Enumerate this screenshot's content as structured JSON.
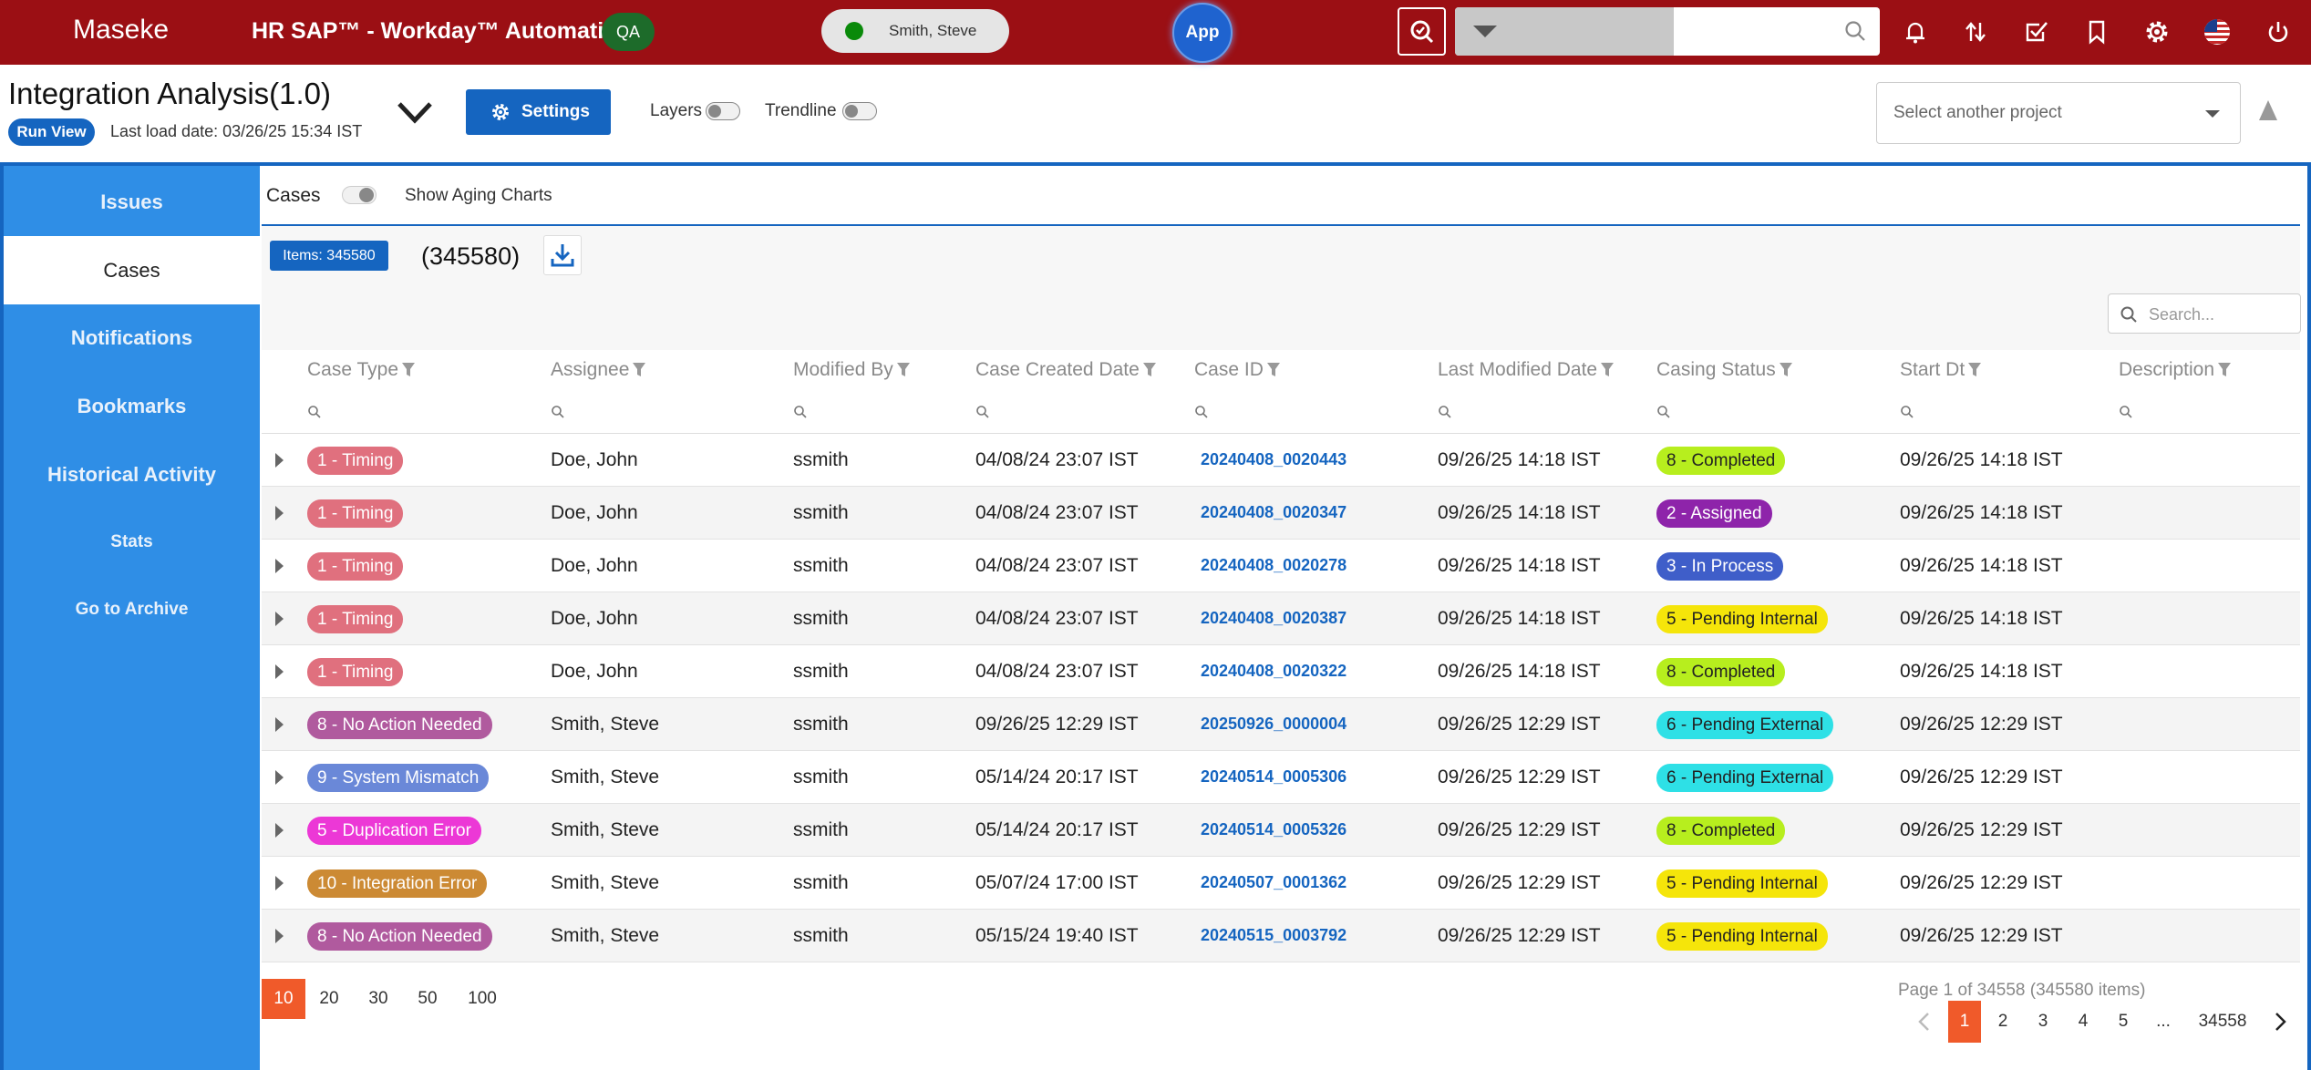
{
  "topbar": {
    "brand": "Maseke",
    "app_title": "HR SAP™ - Workday™ Automation",
    "env_badge": "QA",
    "user_name": "Smith, Steve",
    "app_button": "App",
    "search_placeholder": "",
    "icons": [
      "search-check-icon",
      "magnifier-icon",
      "bell-icon",
      "sort-arrows-icon",
      "checkbox-icon",
      "bookmark-icon",
      "gear-icon",
      "us-flag-icon",
      "power-icon"
    ]
  },
  "header": {
    "title": "Integration Analysis(1.0)",
    "run_view": "Run View",
    "last_load": "Last load date: 03/26/25 15:34 IST",
    "settings": "Settings",
    "layers": "Layers",
    "trendline": "Trendline",
    "project_placeholder": "Select another project"
  },
  "sidebar": {
    "items": [
      {
        "label": "Issues",
        "active": false
      },
      {
        "label": "Cases",
        "active": true
      },
      {
        "label": "Notifications",
        "active": false
      },
      {
        "label": "Bookmarks",
        "active": false
      },
      {
        "label": "Historical Activity",
        "active": false
      },
      {
        "label": "Stats",
        "active": false
      },
      {
        "label": "Go to Archive",
        "active": false
      }
    ]
  },
  "cases": {
    "section_label": "Cases",
    "aging_toggle": "Show Aging Charts",
    "items_badge": "Items: 345580",
    "count": "(345580)",
    "search_placeholder": "Search..."
  },
  "table": {
    "columns": [
      "Case Type",
      "Assignee",
      "Modified By",
      "Case Created Date",
      "Case ID",
      "Last Modified Date",
      "Casing Status",
      "Start Dt",
      "Description"
    ],
    "rows": [
      {
        "type": "1 - Timing",
        "type_color": "#e0707e",
        "assignee": "Doe, John",
        "modified_by": "ssmith",
        "created": "04/08/24 23:07 IST",
        "case_id": "20240408_0020443",
        "last_modified": "09/26/25 14:18 IST",
        "status": "8 - Completed",
        "status_bg": "#b7ee1e",
        "status_fg": "#222",
        "start": "09/26/25 14:18 IST",
        "description": ""
      },
      {
        "type": "1 - Timing",
        "type_color": "#e0707e",
        "assignee": "Doe, John",
        "modified_by": "ssmith",
        "created": "04/08/24 23:07 IST",
        "case_id": "20240408_0020347",
        "last_modified": "09/26/25 14:18 IST",
        "status": "2 - Assigned",
        "status_bg": "#8e24aa",
        "status_fg": "#fff",
        "start": "09/26/25 14:18 IST",
        "description": ""
      },
      {
        "type": "1 - Timing",
        "type_color": "#e0707e",
        "assignee": "Doe, John",
        "modified_by": "ssmith",
        "created": "04/08/24 23:07 IST",
        "case_id": "20240408_0020278",
        "last_modified": "09/26/25 14:18 IST",
        "status": "3 - In Process",
        "status_bg": "#3f5ec9",
        "status_fg": "#fff",
        "start": "09/26/25 14:18 IST",
        "description": ""
      },
      {
        "type": "1 - Timing",
        "type_color": "#e0707e",
        "assignee": "Doe, John",
        "modified_by": "ssmith",
        "created": "04/08/24 23:07 IST",
        "case_id": "20240408_0020387",
        "last_modified": "09/26/25 14:18 IST",
        "status": "5 - Pending Internal",
        "status_bg": "#f5e50a",
        "status_fg": "#222",
        "start": "09/26/25 14:18 IST",
        "description": ""
      },
      {
        "type": "1 - Timing",
        "type_color": "#e0707e",
        "assignee": "Doe, John",
        "modified_by": "ssmith",
        "created": "04/08/24 23:07 IST",
        "case_id": "20240408_0020322",
        "last_modified": "09/26/25 14:18 IST",
        "status": "8 - Completed",
        "status_bg": "#b7ee1e",
        "status_fg": "#222",
        "start": "09/26/25 14:18 IST",
        "description": ""
      },
      {
        "type": "8 - No Action Needed",
        "type_color": "#b05a9e",
        "assignee": "Smith, Steve",
        "modified_by": "ssmith",
        "created": "09/26/25 12:29 IST",
        "case_id": "20250926_0000004",
        "last_modified": "09/26/25 12:29 IST",
        "status": "6 - Pending External",
        "status_bg": "#2ee0e6",
        "status_fg": "#222",
        "start": "09/26/25 12:29 IST",
        "description": ""
      },
      {
        "type": "9 - System Mismatch",
        "type_color": "#6a88d8",
        "assignee": "Smith, Steve",
        "modified_by": "ssmith",
        "created": "05/14/24 20:17 IST",
        "case_id": "20240514_0005306",
        "last_modified": "09/26/25 12:29 IST",
        "status": "6 - Pending External",
        "status_bg": "#2ee0e6",
        "status_fg": "#222",
        "start": "09/26/25 12:29 IST",
        "description": ""
      },
      {
        "type": "5 - Duplication Error",
        "type_color": "#ec38d6",
        "assignee": "Smith, Steve",
        "modified_by": "ssmith",
        "created": "05/14/24 20:17 IST",
        "case_id": "20240514_0005326",
        "last_modified": "09/26/25 12:29 IST",
        "status": "8 - Completed",
        "status_bg": "#b7ee1e",
        "status_fg": "#222",
        "start": "09/26/25 12:29 IST",
        "description": ""
      },
      {
        "type": "10 - Integration Error",
        "type_color": "#cc8a34",
        "assignee": "Smith, Steve",
        "modified_by": "ssmith",
        "created": "05/07/24 17:00 IST",
        "case_id": "20240507_0001362",
        "last_modified": "09/26/25 12:29 IST",
        "status": "5 - Pending Internal",
        "status_bg": "#f5e50a",
        "status_fg": "#222",
        "start": "09/26/25 12:29 IST",
        "description": ""
      },
      {
        "type": "8 - No Action Needed",
        "type_color": "#b05a9e",
        "assignee": "Smith, Steve",
        "modified_by": "ssmith",
        "created": "05/15/24 19:40 IST",
        "case_id": "20240515_0003792",
        "last_modified": "09/26/25 12:29 IST",
        "status": "5 - Pending Internal",
        "status_bg": "#f5e50a",
        "status_fg": "#222",
        "start": "09/26/25 12:29 IST",
        "description": ""
      }
    ]
  },
  "pager": {
    "sizes": [
      "10",
      "20",
      "30",
      "50",
      "100"
    ],
    "selected_size": "10",
    "info": "Page 1 of 34558 (345580 items)",
    "pages": [
      "1",
      "2",
      "3",
      "4",
      "5",
      "...",
      "34558"
    ],
    "current_page": "1"
  },
  "colors": {
    "topbar": "#9b0f14",
    "accent": "#1565c0",
    "sidebar": "#2f8ee6",
    "pager_active": "#f05a2a"
  }
}
